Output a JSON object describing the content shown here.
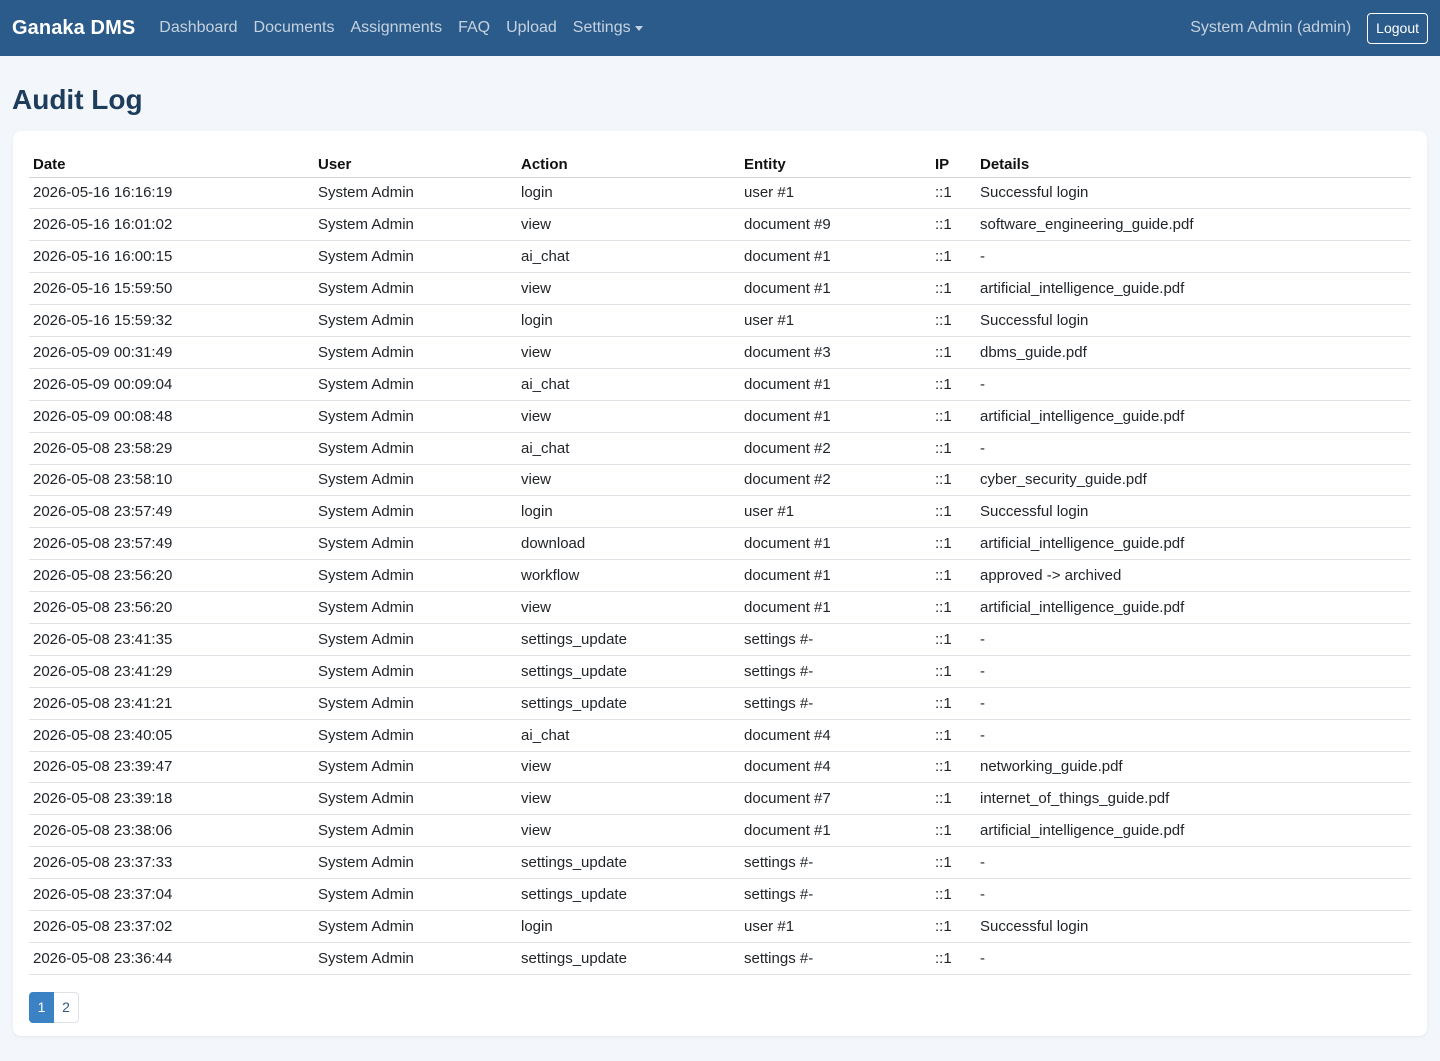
{
  "nav": {
    "brand": "Ganaka DMS",
    "links": [
      "Dashboard",
      "Documents",
      "Assignments",
      "FAQ",
      "Upload"
    ],
    "settings_label": "Settings",
    "user_label": "System Admin (admin)",
    "logout_label": "Logout"
  },
  "page": {
    "title": "Audit Log"
  },
  "table": {
    "headers": [
      "Date",
      "User",
      "Action",
      "Entity",
      "IP",
      "Details"
    ],
    "rows": [
      [
        "2026-05-16 16:16:19",
        "System Admin",
        "login",
        "user #1",
        "::1",
        "Successful login"
      ],
      [
        "2026-05-16 16:01:02",
        "System Admin",
        "view",
        "document #9",
        "::1",
        "software_engineering_guide.pdf"
      ],
      [
        "2026-05-16 16:00:15",
        "System Admin",
        "ai_chat",
        "document #1",
        "::1",
        "-"
      ],
      [
        "2026-05-16 15:59:50",
        "System Admin",
        "view",
        "document #1",
        "::1",
        "artificial_intelligence_guide.pdf"
      ],
      [
        "2026-05-16 15:59:32",
        "System Admin",
        "login",
        "user #1",
        "::1",
        "Successful login"
      ],
      [
        "2026-05-09 00:31:49",
        "System Admin",
        "view",
        "document #3",
        "::1",
        "dbms_guide.pdf"
      ],
      [
        "2026-05-09 00:09:04",
        "System Admin",
        "ai_chat",
        "document #1",
        "::1",
        "-"
      ],
      [
        "2026-05-09 00:08:48",
        "System Admin",
        "view",
        "document #1",
        "::1",
        "artificial_intelligence_guide.pdf"
      ],
      [
        "2026-05-08 23:58:29",
        "System Admin",
        "ai_chat",
        "document #2",
        "::1",
        "-"
      ],
      [
        "2026-05-08 23:58:10",
        "System Admin",
        "view",
        "document #2",
        "::1",
        "cyber_security_guide.pdf"
      ],
      [
        "2026-05-08 23:57:49",
        "System Admin",
        "login",
        "user #1",
        "::1",
        "Successful login"
      ],
      [
        "2026-05-08 23:57:49",
        "System Admin",
        "download",
        "document #1",
        "::1",
        "artificial_intelligence_guide.pdf"
      ],
      [
        "2026-05-08 23:56:20",
        "System Admin",
        "workflow",
        "document #1",
        "::1",
        "approved -> archived"
      ],
      [
        "2026-05-08 23:56:20",
        "System Admin",
        "view",
        "document #1",
        "::1",
        "artificial_intelligence_guide.pdf"
      ],
      [
        "2026-05-08 23:41:35",
        "System Admin",
        "settings_update",
        "settings #-",
        "::1",
        "-"
      ],
      [
        "2026-05-08 23:41:29",
        "System Admin",
        "settings_update",
        "settings #-",
        "::1",
        "-"
      ],
      [
        "2026-05-08 23:41:21",
        "System Admin",
        "settings_update",
        "settings #-",
        "::1",
        "-"
      ],
      [
        "2026-05-08 23:40:05",
        "System Admin",
        "ai_chat",
        "document #4",
        "::1",
        "-"
      ],
      [
        "2026-05-08 23:39:47",
        "System Admin",
        "view",
        "document #4",
        "::1",
        "networking_guide.pdf"
      ],
      [
        "2026-05-08 23:39:18",
        "System Admin",
        "view",
        "document #7",
        "::1",
        "internet_of_things_guide.pdf"
      ],
      [
        "2026-05-08 23:38:06",
        "System Admin",
        "view",
        "document #1",
        "::1",
        "artificial_intelligence_guide.pdf"
      ],
      [
        "2026-05-08 23:37:33",
        "System Admin",
        "settings_update",
        "settings #-",
        "::1",
        "-"
      ],
      [
        "2026-05-08 23:37:04",
        "System Admin",
        "settings_update",
        "settings #-",
        "::1",
        "-"
      ],
      [
        "2026-05-08 23:37:02",
        "System Admin",
        "login",
        "user #1",
        "::1",
        "Successful login"
      ],
      [
        "2026-05-08 23:36:44",
        "System Admin",
        "settings_update",
        "settings #-",
        "::1",
        "-"
      ]
    ]
  },
  "pagination": {
    "pages": [
      "1",
      "2"
    ],
    "current": "1"
  },
  "colors": {
    "navbar": "#2b5b8a",
    "active_page": "#3b82c4",
    "title": "#1e3d5c"
  }
}
